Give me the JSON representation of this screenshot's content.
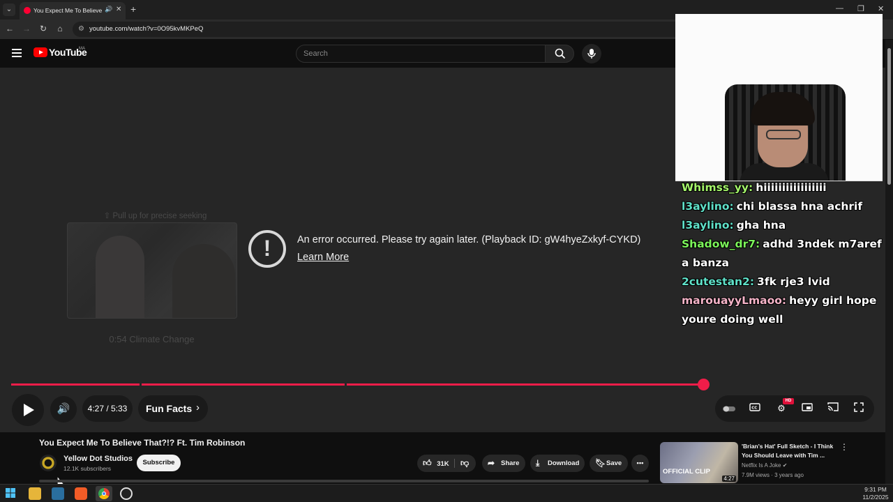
{
  "browser": {
    "tab_title": "You Expect Me To Believe That?!? Ft. Tim Robinson",
    "url": "youtube.com/watch?v=0O95kvMKPeQ",
    "new_tab": "+",
    "close_tab": "✕"
  },
  "youtube": {
    "logo_text": "YouTube",
    "country_code": "MA",
    "search_placeholder": "Search"
  },
  "player": {
    "pull_up_hint": "⇧ Pull up for precise seeking",
    "preview_caption": "0:54  Climate Change",
    "error_message": "An error occurred. Please try again later. (Playback ID: gW4hyeZxkyf-CYKD)",
    "learn_more": "Learn More",
    "time": "4:27 / 5:33",
    "chapter": "Fun Facts",
    "hd_badge": "HD",
    "progress_fraction": 0.805
  },
  "video": {
    "title": "You Expect Me To Believe That?!? Ft. Tim Robinson",
    "channel": "Yellow Dot Studios",
    "subscribers": "12.1K subscribers",
    "subscribe_label": "Subscribe",
    "likes": "31K",
    "share_label": "Share",
    "download_label": "Download",
    "save_label": "Save"
  },
  "recommended": {
    "title": "'Brian's Hat' Full Sketch - I Think You Should Leave with Tim ...",
    "channel": "Netflix Is A Joke",
    "meta": "7.9M views · 3 years ago",
    "duration": "4:27",
    "thumb_text": "OFFICIAL CLIP"
  },
  "chat": [
    {
      "user": "Whimss_yy:",
      "text": "hiiiiiiiiiiiiiiiii",
      "color": "#a4f56a"
    },
    {
      "user": "l3aylino:",
      "text": "chi blassa hna achrif",
      "color": "#5fe0c8"
    },
    {
      "user": "l3aylino:",
      "text": "gha hna",
      "color": "#5fe0c8"
    },
    {
      "user": "Shadow_dr7:",
      "text": "adhd 3ndek m7aref a banza",
      "color": "#7cf55a"
    },
    {
      "user": "2cutestan2:",
      "text": "3fk rje3 lvid",
      "color": "#5fe0c8"
    },
    {
      "user": "marouayyLmaoo:",
      "text": "heyy girl hope youre doing well",
      "color": "#f5b4c8"
    }
  ],
  "taskbar": {
    "time": "9:31 PM",
    "date": "11/2/2025"
  },
  "colors": {
    "accent": "#f01d49",
    "background": "#0f0f0f",
    "player_bg": "#262626"
  }
}
